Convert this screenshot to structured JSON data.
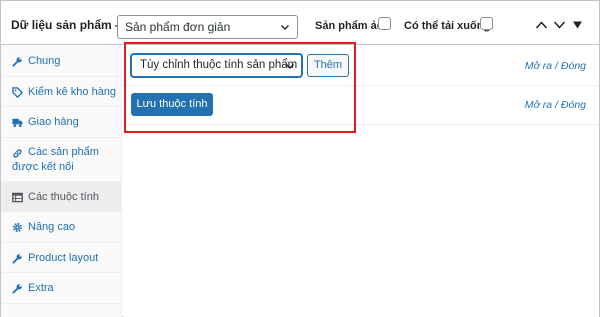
{
  "header": {
    "title": "Dữ liệu sản phẩm —",
    "product_type": "Sản phẩm đơn giản",
    "virtual_label": "Sản phẩm ảo:",
    "downloadable_label": "Có thể tải xuống:"
  },
  "sidebar": {
    "items": [
      {
        "label": "Chung",
        "icon": "wrench-icon"
      },
      {
        "label": "Kiểm kê kho hàng",
        "icon": "tag-icon"
      },
      {
        "label": "Giao hàng",
        "icon": "truck-icon"
      },
      {
        "label": "Các sản phẩm được kết nối",
        "line1": "Các sản phẩm",
        "line2": "được kết nối",
        "icon": "link-icon"
      },
      {
        "label": "Các thuộc tính",
        "icon": "table-icon",
        "active": true
      },
      {
        "label": "Nâng cao",
        "icon": "gear-icon"
      },
      {
        "label": "Product layout",
        "icon": "wrench-icon"
      },
      {
        "label": "Extra",
        "icon": "wrench-icon"
      }
    ]
  },
  "attributes": {
    "select_value": "Tùy chỉnh thuộc tính sản phẩm",
    "add_label": "Thêm",
    "toggle_label": "Mở ra / Đóng",
    "save_label": "Lưu thuộc tính"
  },
  "colors": {
    "link": "#2271b1",
    "primary_button": "#2271b1",
    "highlight": "#e11d21"
  }
}
